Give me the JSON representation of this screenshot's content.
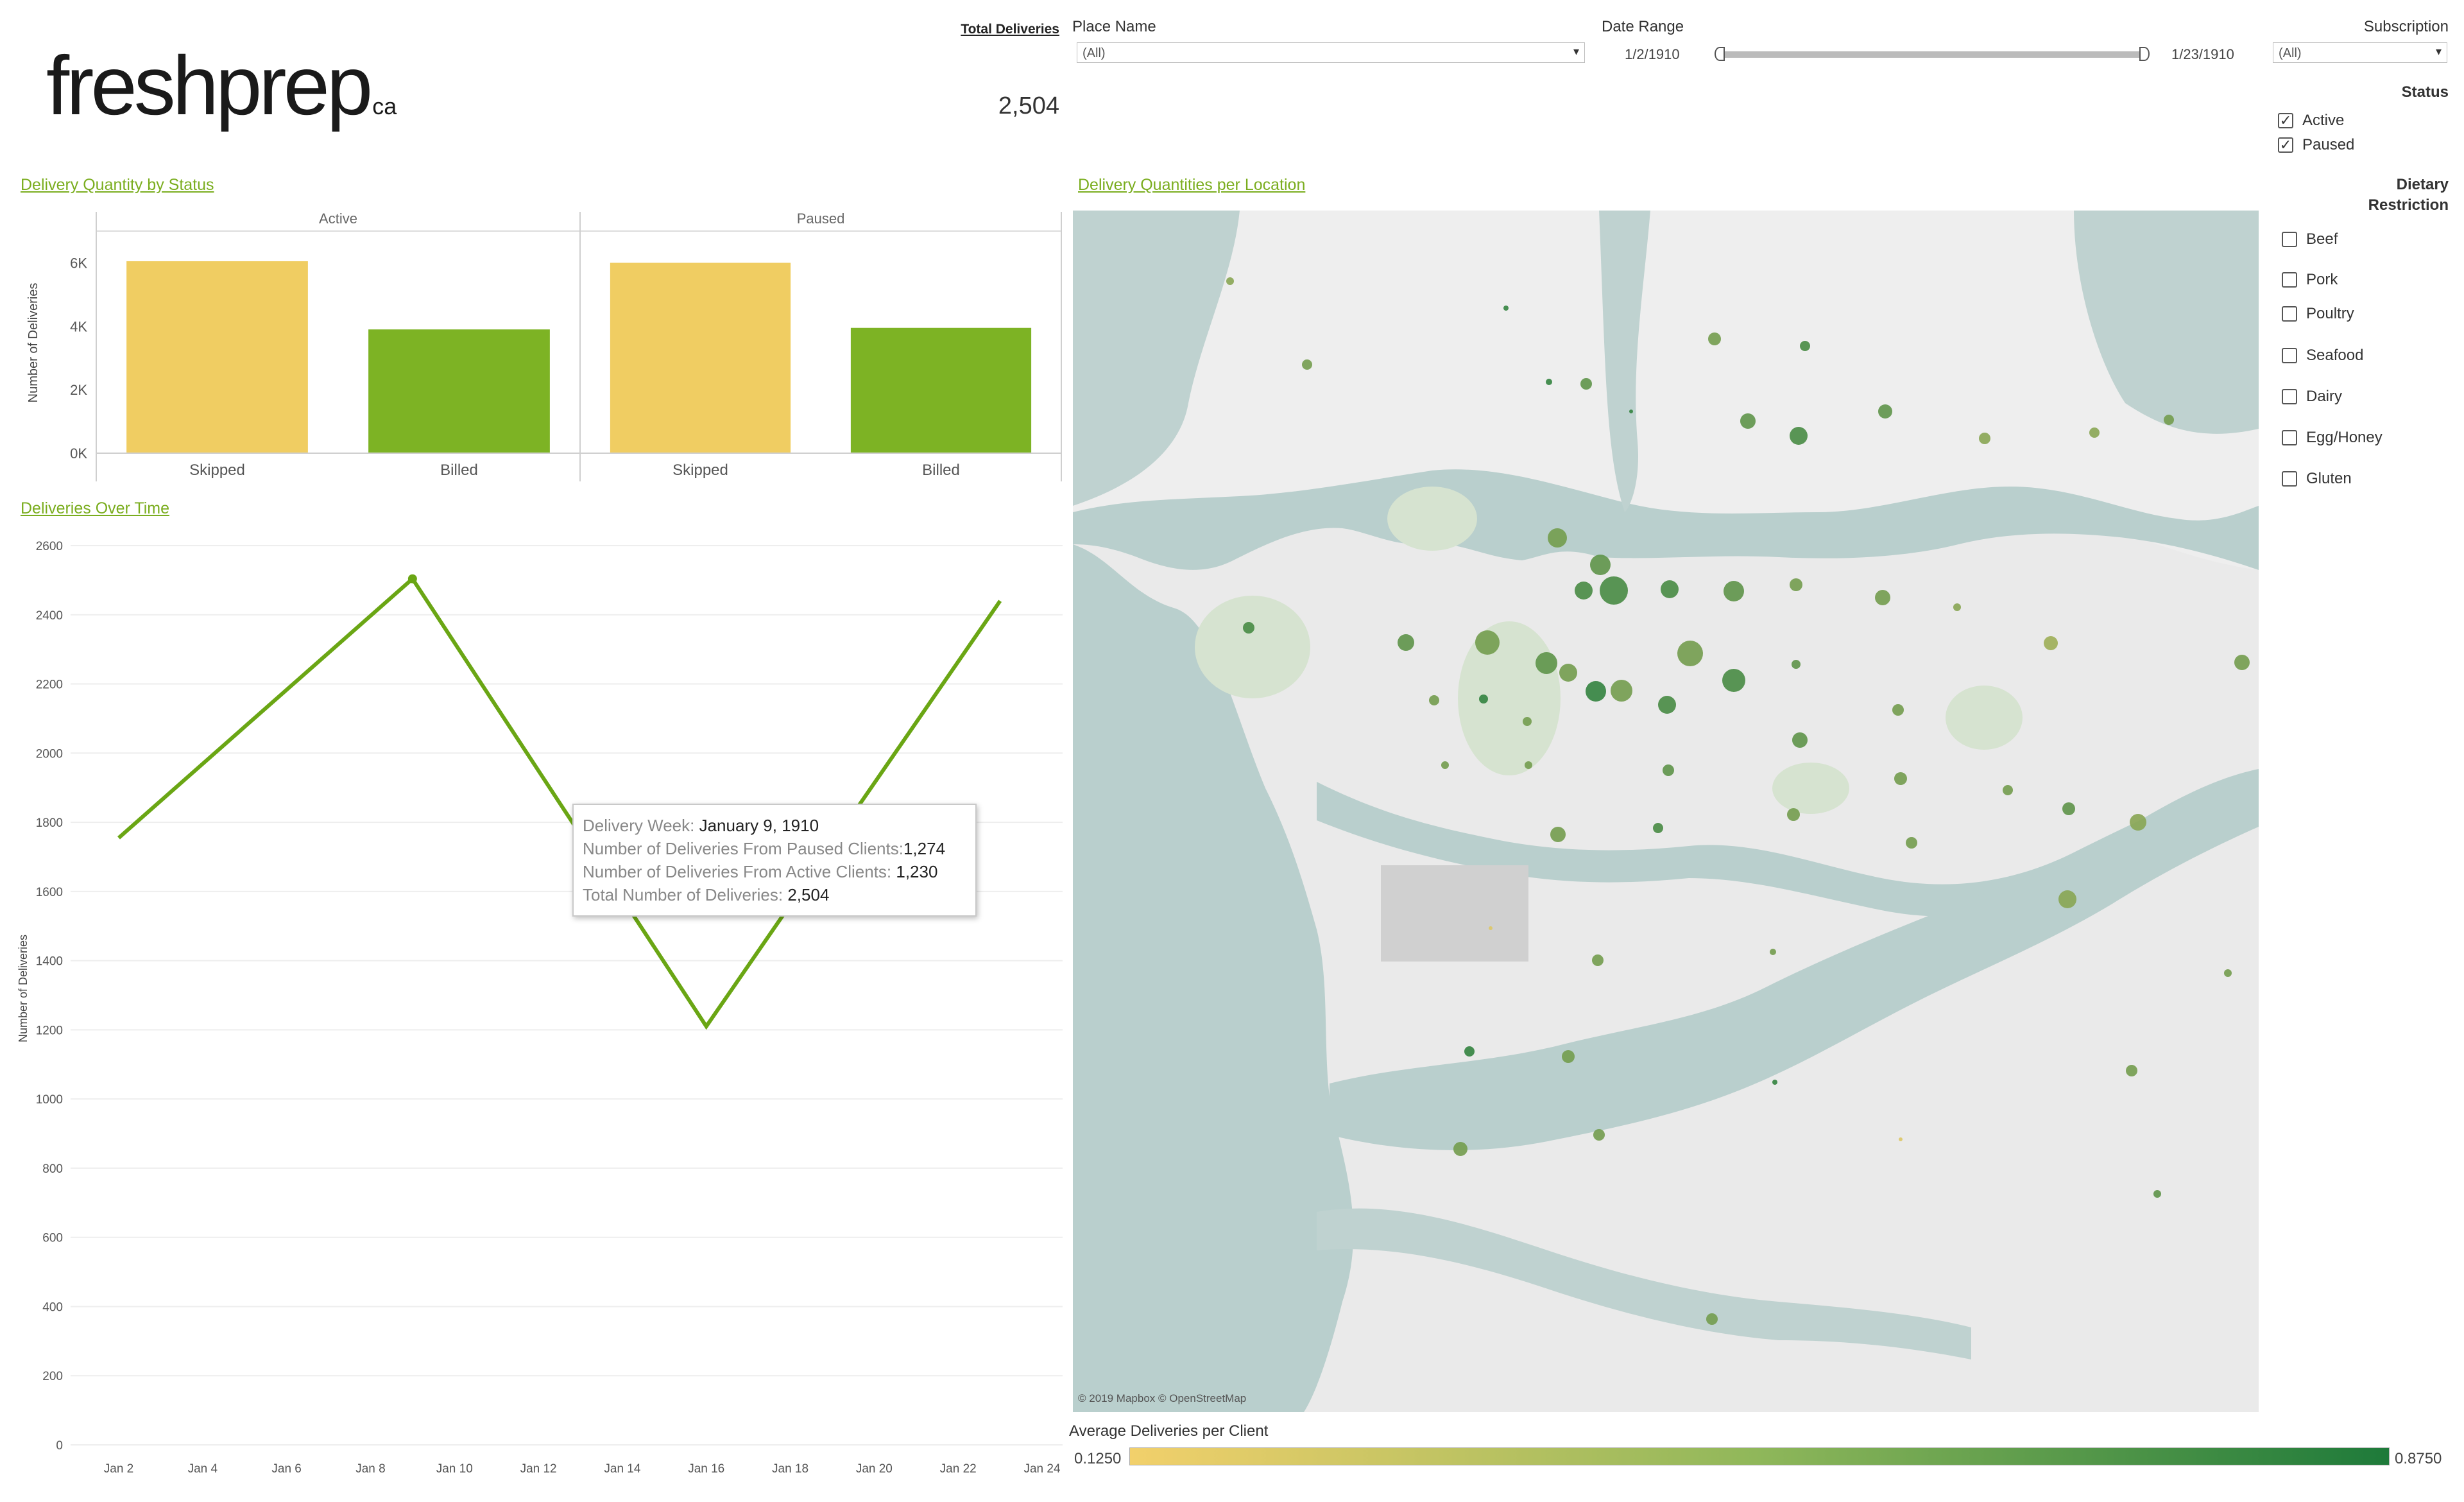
{
  "logo": {
    "text": "freshprep",
    "suffix": "ca"
  },
  "kpi": {
    "title": "Total Deliveries",
    "value": "2,504"
  },
  "filters": {
    "place_name": {
      "label": "Place Name",
      "value": "(All)"
    },
    "date_range": {
      "label": "Date Range",
      "start": "1/2/1910",
      "end": "1/23/1910"
    },
    "subscription": {
      "label": "Subscription",
      "value": "(All)"
    },
    "status": {
      "label": "Status",
      "options": [
        {
          "label": "Active",
          "checked": true
        },
        {
          "label": "Paused",
          "checked": true
        }
      ]
    },
    "dietary": {
      "label_line1": "Dietary",
      "label_line2": "Restriction",
      "options": [
        {
          "label": "Beef",
          "checked": false
        },
        {
          "label": "Pork",
          "checked": false
        },
        {
          "label": "Poultry",
          "checked": false
        },
        {
          "label": "Seafood",
          "checked": false
        },
        {
          "label": "Dairy",
          "checked": false
        },
        {
          "label": "Egg/Honey",
          "checked": false
        },
        {
          "label": "Gluten",
          "checked": false
        }
      ]
    }
  },
  "sections": {
    "bar_title": "Delivery Quantity by Status",
    "line_title": "Deliveries Over Time",
    "map_title": "Delivery Quantities  per Location"
  },
  "map": {
    "attribution": "© 2019 Mapbox © OpenStreetMap"
  },
  "legend": {
    "title": "Average Deliveries per Client",
    "min": "0.1250",
    "max": "0.8750",
    "color_min": "#f2d06b",
    "color_max": "#1e7a3a"
  },
  "tooltip": {
    "week_label": "Delivery Week: ",
    "week_value": "January 9, 1910",
    "paused_label": "Number of Deliveries From Paused Clients:",
    "paused_value": "1,274",
    "active_label": "Number of Deliveries From Active Clients: ",
    "active_value": "1,230",
    "total_label": "Total Number of Deliveries: ",
    "total_value": "2,504"
  },
  "colors": {
    "accent": "#7aad1e",
    "skipped": "#f0cd62",
    "billed": "#7db324",
    "line": "#6aa614"
  },
  "chart_data": [
    {
      "type": "bar",
      "title": "Delivery Quantity by Status",
      "ylabel": "Number of Deliveries",
      "panels": [
        "Active",
        "Paused"
      ],
      "categories": [
        "Skipped",
        "Billed"
      ],
      "series": [
        {
          "panel": "Active",
          "values": [
            6050,
            3900
          ]
        },
        {
          "panel": "Paused",
          "values": [
            6000,
            3950
          ]
        }
      ],
      "yticks": [
        "0K",
        "2K",
        "4K",
        "6K"
      ],
      "ylim": [
        0,
        7000
      ],
      "grid": false
    },
    {
      "type": "line",
      "title": "Deliveries Over Time",
      "ylabel": "Number of Deliveries",
      "x": [
        "Jan 2",
        "Jan 9",
        "Jan 16",
        "Jan 23"
      ],
      "x_days": [
        2,
        9,
        16,
        23
      ],
      "values": [
        1755,
        2504,
        1210,
        2440
      ],
      "xticks": [
        "Jan 2",
        "Jan 4",
        "Jan 6",
        "Jan 8",
        "Jan 10",
        "Jan 12",
        "Jan 14",
        "Jan 16",
        "Jan 18",
        "Jan 20",
        "Jan 22",
        "Jan 24"
      ],
      "yticks": [
        0,
        200,
        400,
        600,
        800,
        1000,
        1200,
        1400,
        1600,
        1800,
        2000,
        2200,
        2400,
        2600
      ],
      "ylim": [
        0,
        2600
      ],
      "xlim": [
        2,
        24
      ],
      "grid": true
    }
  ]
}
